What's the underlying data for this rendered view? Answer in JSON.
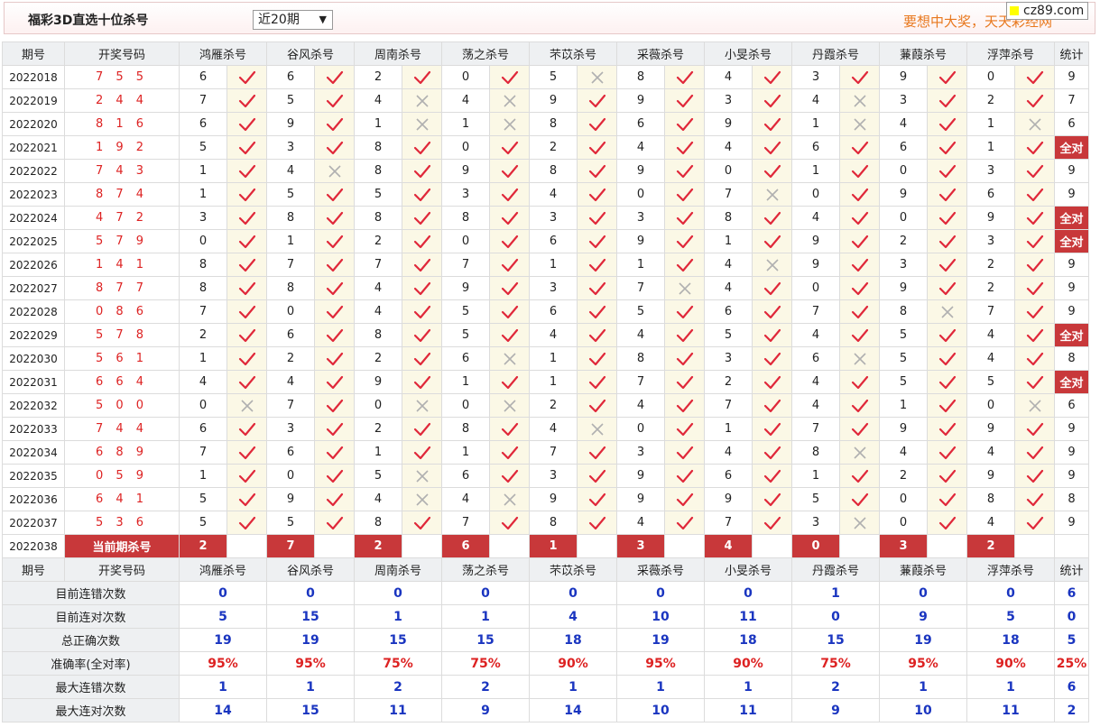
{
  "header": {
    "title": "福彩3D直选十位杀号",
    "select_value": "近20期",
    "slogan": "要想中大奖，天天彩经网",
    "logo": "cz89.com"
  },
  "columns": {
    "period": "期号",
    "draw": "开奖号码",
    "experts": [
      "鸿雁杀号",
      "谷风杀号",
      "周南杀号",
      "荡之杀号",
      "芣苡杀号",
      "采薇杀号",
      "小旻杀号",
      "丹霞杀号",
      "蒹葭杀号",
      "浮萍杀号"
    ],
    "stat": "统计"
  },
  "rows": [
    {
      "period": "2022018",
      "draw": "7 5 5",
      "nums": [
        6,
        6,
        2,
        0,
        5,
        8,
        4,
        3,
        9,
        0
      ],
      "ok": [
        1,
        1,
        1,
        1,
        0,
        1,
        1,
        1,
        1,
        1
      ],
      "stat": "9"
    },
    {
      "period": "2022019",
      "draw": "2 4 4",
      "nums": [
        7,
        5,
        4,
        4,
        9,
        9,
        3,
        4,
        3,
        2
      ],
      "ok": [
        1,
        1,
        0,
        0,
        1,
        1,
        1,
        0,
        1,
        1
      ],
      "stat": "7"
    },
    {
      "period": "2022020",
      "draw": "8 1 6",
      "nums": [
        6,
        9,
        1,
        1,
        8,
        6,
        9,
        1,
        4,
        1
      ],
      "ok": [
        1,
        1,
        0,
        0,
        1,
        1,
        1,
        0,
        1,
        0
      ],
      "stat": "6"
    },
    {
      "period": "2022021",
      "draw": "1 9 2",
      "nums": [
        5,
        3,
        8,
        0,
        2,
        4,
        4,
        6,
        6,
        1
      ],
      "ok": [
        1,
        1,
        1,
        1,
        1,
        1,
        1,
        1,
        1,
        1
      ],
      "stat": "全对"
    },
    {
      "period": "2022022",
      "draw": "7 4 3",
      "nums": [
        1,
        4,
        8,
        9,
        8,
        9,
        0,
        1,
        0,
        3
      ],
      "ok": [
        1,
        0,
        1,
        1,
        1,
        1,
        1,
        1,
        1,
        1
      ],
      "stat": "9"
    },
    {
      "period": "2022023",
      "draw": "8 7 4",
      "nums": [
        1,
        5,
        5,
        3,
        4,
        0,
        7,
        0,
        9,
        6
      ],
      "ok": [
        1,
        1,
        1,
        1,
        1,
        1,
        0,
        1,
        1,
        1
      ],
      "stat": "9"
    },
    {
      "period": "2022024",
      "draw": "4 7 2",
      "nums": [
        3,
        8,
        8,
        8,
        3,
        3,
        8,
        4,
        0,
        9
      ],
      "ok": [
        1,
        1,
        1,
        1,
        1,
        1,
        1,
        1,
        1,
        1
      ],
      "stat": "全对"
    },
    {
      "period": "2022025",
      "draw": "5 7 9",
      "nums": [
        0,
        1,
        2,
        0,
        6,
        9,
        1,
        9,
        2,
        3
      ],
      "ok": [
        1,
        1,
        1,
        1,
        1,
        1,
        1,
        1,
        1,
        1
      ],
      "stat": "全对"
    },
    {
      "period": "2022026",
      "draw": "1 4 1",
      "nums": [
        8,
        7,
        7,
        7,
        1,
        1,
        4,
        9,
        3,
        2
      ],
      "ok": [
        1,
        1,
        1,
        1,
        1,
        1,
        0,
        1,
        1,
        1
      ],
      "stat": "9"
    },
    {
      "period": "2022027",
      "draw": "8 7 7",
      "nums": [
        8,
        8,
        4,
        9,
        3,
        7,
        4,
        0,
        9,
        2
      ],
      "ok": [
        1,
        1,
        1,
        1,
        1,
        0,
        1,
        1,
        1,
        1
      ],
      "stat": "9"
    },
    {
      "period": "2022028",
      "draw": "0 8 6",
      "nums": [
        7,
        0,
        4,
        5,
        6,
        5,
        6,
        7,
        8,
        7
      ],
      "ok": [
        1,
        1,
        1,
        1,
        1,
        1,
        1,
        1,
        0,
        1
      ],
      "stat": "9"
    },
    {
      "period": "2022029",
      "draw": "5 7 8",
      "nums": [
        2,
        6,
        8,
        5,
        4,
        4,
        5,
        4,
        5,
        4
      ],
      "ok": [
        1,
        1,
        1,
        1,
        1,
        1,
        1,
        1,
        1,
        1
      ],
      "stat": "全对"
    },
    {
      "period": "2022030",
      "draw": "5 6 1",
      "nums": [
        1,
        2,
        2,
        6,
        1,
        8,
        3,
        6,
        5,
        4
      ],
      "ok": [
        1,
        1,
        1,
        0,
        1,
        1,
        1,
        0,
        1,
        1
      ],
      "stat": "8"
    },
    {
      "period": "2022031",
      "draw": "6 6 4",
      "nums": [
        4,
        4,
        9,
        1,
        1,
        7,
        2,
        4,
        5,
        5
      ],
      "ok": [
        1,
        1,
        1,
        1,
        1,
        1,
        1,
        1,
        1,
        1
      ],
      "stat": "全对"
    },
    {
      "period": "2022032",
      "draw": "5 0 0",
      "nums": [
        0,
        7,
        0,
        0,
        2,
        4,
        7,
        4,
        1,
        0
      ],
      "ok": [
        0,
        1,
        0,
        0,
        1,
        1,
        1,
        1,
        1,
        0
      ],
      "stat": "6"
    },
    {
      "period": "2022033",
      "draw": "7 4 4",
      "nums": [
        6,
        3,
        2,
        8,
        4,
        0,
        1,
        7,
        9,
        9
      ],
      "ok": [
        1,
        1,
        1,
        1,
        0,
        1,
        1,
        1,
        1,
        1
      ],
      "stat": "9"
    },
    {
      "period": "2022034",
      "draw": "6 8 9",
      "nums": [
        7,
        6,
        1,
        1,
        7,
        3,
        4,
        8,
        4,
        4
      ],
      "ok": [
        1,
        1,
        1,
        1,
        1,
        1,
        1,
        0,
        1,
        1
      ],
      "stat": "9"
    },
    {
      "period": "2022035",
      "draw": "0 5 9",
      "nums": [
        1,
        0,
        5,
        6,
        3,
        9,
        6,
        1,
        2,
        9
      ],
      "ok": [
        1,
        1,
        0,
        1,
        1,
        1,
        1,
        1,
        1,
        1
      ],
      "stat": "9"
    },
    {
      "period": "2022036",
      "draw": "6 4 1",
      "nums": [
        5,
        9,
        4,
        4,
        9,
        9,
        9,
        5,
        0,
        8
      ],
      "ok": [
        1,
        1,
        0,
        0,
        1,
        1,
        1,
        1,
        1,
        1
      ],
      "stat": "8"
    },
    {
      "period": "2022037",
      "draw": "5 3 6",
      "nums": [
        5,
        5,
        8,
        7,
        8,
        4,
        7,
        3,
        0,
        4
      ],
      "ok": [
        1,
        1,
        1,
        1,
        1,
        1,
        1,
        0,
        1,
        1
      ],
      "stat": "9"
    }
  ],
  "current": {
    "period": "2022038",
    "label": "当前期杀号",
    "nums": [
      "2",
      "7",
      "2",
      "6",
      "1",
      "3",
      "4",
      "0",
      "3",
      "2"
    ]
  },
  "summary": [
    {
      "label": "目前连错次数",
      "vals": [
        "0",
        "0",
        "0",
        "0",
        "0",
        "0",
        "0",
        "1",
        "0",
        "0"
      ],
      "stat": "6"
    },
    {
      "label": "目前连对次数",
      "vals": [
        "5",
        "15",
        "1",
        "1",
        "4",
        "10",
        "11",
        "0",
        "9",
        "5"
      ],
      "stat": "0"
    },
    {
      "label": "总正确次数",
      "vals": [
        "19",
        "19",
        "15",
        "15",
        "18",
        "19",
        "18",
        "15",
        "19",
        "18"
      ],
      "stat": "5"
    },
    {
      "label": "准确率(全对率)",
      "vals": [
        "95%",
        "95%",
        "75%",
        "75%",
        "90%",
        "95%",
        "90%",
        "75%",
        "95%",
        "90%"
      ],
      "stat": "25%",
      "red": true
    },
    {
      "label": "最大连错次数",
      "vals": [
        "1",
        "1",
        "2",
        "2",
        "1",
        "1",
        "1",
        "2",
        "1",
        "1"
      ],
      "stat": "6"
    },
    {
      "label": "最大连对次数",
      "vals": [
        "14",
        "15",
        "11",
        "9",
        "14",
        "10",
        "11",
        "9",
        "10",
        "11"
      ],
      "stat": "2"
    }
  ],
  "icons": {
    "ok": "check-icon",
    "bad": "cross-icon"
  },
  "colors": {
    "accent": "#c8383a",
    "check": "#e0283a",
    "cross": "#b0b0b0",
    "value": "#1a35c0"
  }
}
